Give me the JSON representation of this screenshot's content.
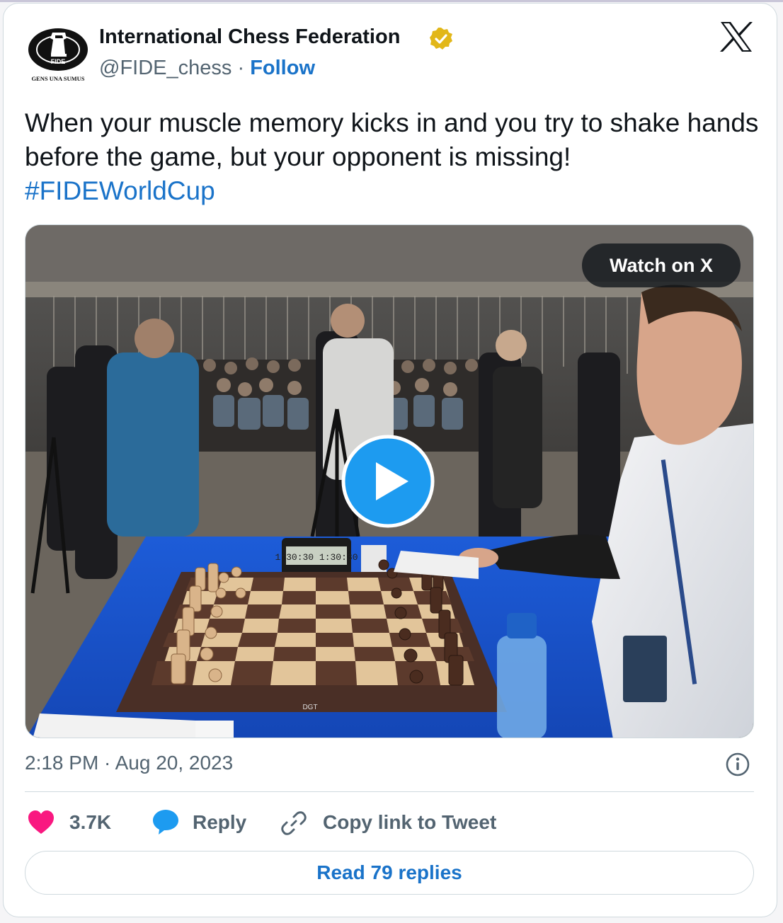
{
  "author": {
    "name": "International Chess Federation",
    "handle": "@FIDE_chess",
    "separator": "·",
    "follow_label": "Follow",
    "logo_text_top": "FIDE",
    "logo_text_bottom": "GENS UNA SUMUS"
  },
  "tweet": {
    "text": "When your muscle memory kicks in and you try to shake hands before the game, but your opponent is missing!",
    "hashtag": "#FIDEWorldCup"
  },
  "media": {
    "watch_label": "Watch on X",
    "clock_text": "1:30:30  1:30:30",
    "board_brand": "DGT"
  },
  "meta": {
    "timestamp": "2:18 PM · Aug 20, 2023"
  },
  "actions": {
    "likes": "3.7K",
    "reply_label": "Reply",
    "copy_label": "Copy link to Tweet",
    "read_replies_label": "Read 79 replies"
  },
  "colors": {
    "link": "#1a73c9",
    "heart": "#f91880",
    "reply_bubble": "#1d9bf0",
    "verified_badge": "#e2b719",
    "text_secondary": "#536471"
  },
  "icons": [
    "fide-logo",
    "verified-badge-icon",
    "x-logo-icon",
    "play-icon",
    "info-icon",
    "heart-icon",
    "reply-icon",
    "link-icon"
  ]
}
